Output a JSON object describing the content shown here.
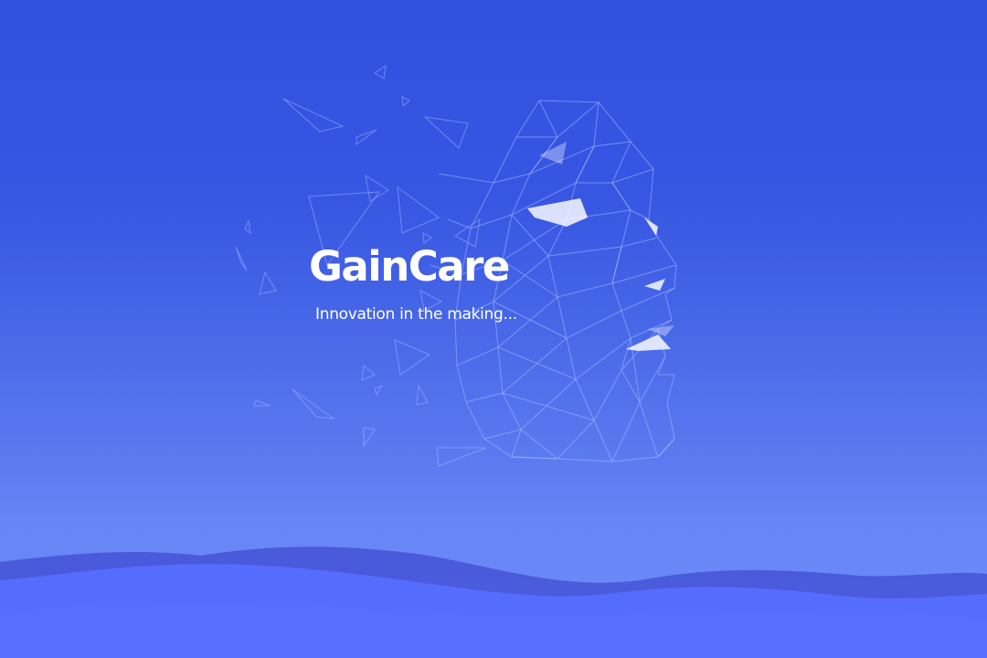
{
  "brand": {
    "name": "GainCare",
    "tagline": "Innovation in the making..."
  },
  "colors": {
    "background_top": "#3250e0",
    "background_bottom": "#6d8bf7",
    "wave_dark": "#4454d6",
    "wave_main": "#566cff",
    "text": "#ffffff"
  },
  "decorations": {
    "hero_illustration": "low-poly-face-mesh",
    "footer": "waves"
  }
}
